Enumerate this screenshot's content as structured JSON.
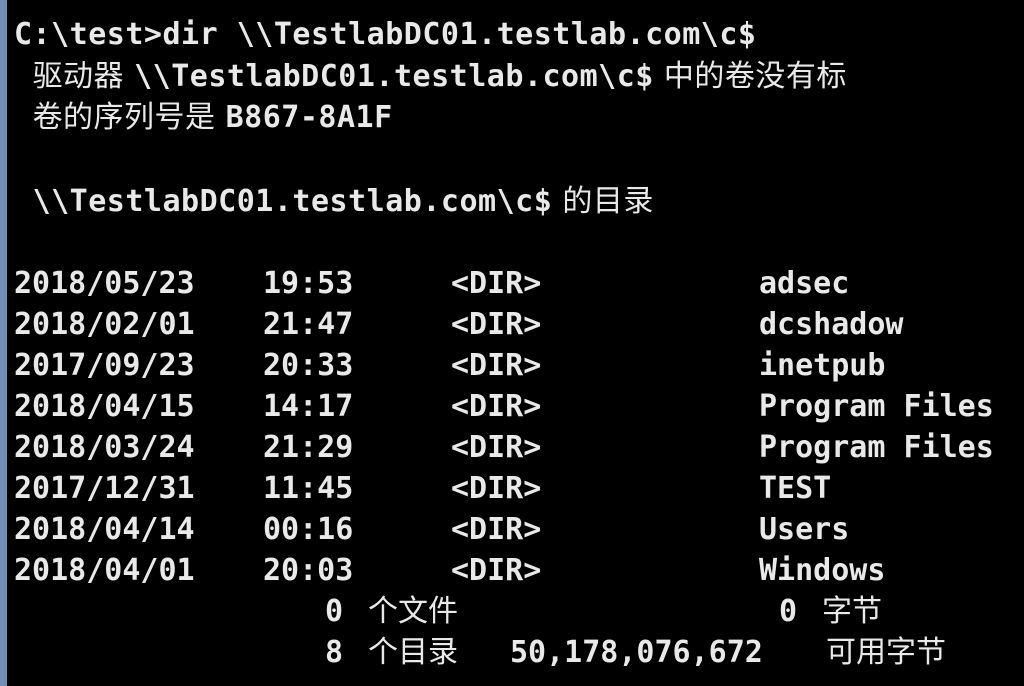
{
  "console": {
    "command": "C:\\test>dir \\\\TestlabDC01.testlab.com\\c$",
    "volume": {
      "prefix": "驱动器 ",
      "path": "\\\\TestlabDC01.testlab.com\\c$",
      "suffix": " 中的卷没有标"
    },
    "serial": {
      "label": "卷的序列号是 ",
      "value": "B867-8A1F"
    },
    "directory_of": {
      "path": "\\\\TestlabDC01.testlab.com\\c$",
      "suffix": " 的目录"
    },
    "entries": [
      {
        "date": "2018/05/23",
        "time": "19:53",
        "type": "<DIR>",
        "name": "adsec"
      },
      {
        "date": "2018/02/01",
        "time": "21:47",
        "type": "<DIR>",
        "name": "dcshadow"
      },
      {
        "date": "2017/09/23",
        "time": "20:33",
        "type": "<DIR>",
        "name": "inetpub"
      },
      {
        "date": "2018/04/15",
        "time": "14:17",
        "type": "<DIR>",
        "name": "Program Files"
      },
      {
        "date": "2018/03/24",
        "time": "21:29",
        "type": "<DIR>",
        "name": "Program Files"
      },
      {
        "date": "2017/12/31",
        "time": "11:45",
        "type": "<DIR>",
        "name": "TEST"
      },
      {
        "date": "2018/04/14",
        "time": "00:16",
        "type": "<DIR>",
        "name": "Users"
      },
      {
        "date": "2018/04/01",
        "time": "20:03",
        "type": "<DIR>",
        "name": "Windows"
      }
    ],
    "summary_files": {
      "count": "0",
      "label": "个文件",
      "bytes": "0",
      "bytes_label": "字节"
    },
    "summary_dirs": {
      "count": "8",
      "label": "个目录",
      "bytes": "50,178,076,672",
      "bytes_label": "可用字节"
    }
  },
  "colors": {
    "background": "#000000",
    "text": "#e9e9e9",
    "window_edge": "#6f90b8"
  }
}
